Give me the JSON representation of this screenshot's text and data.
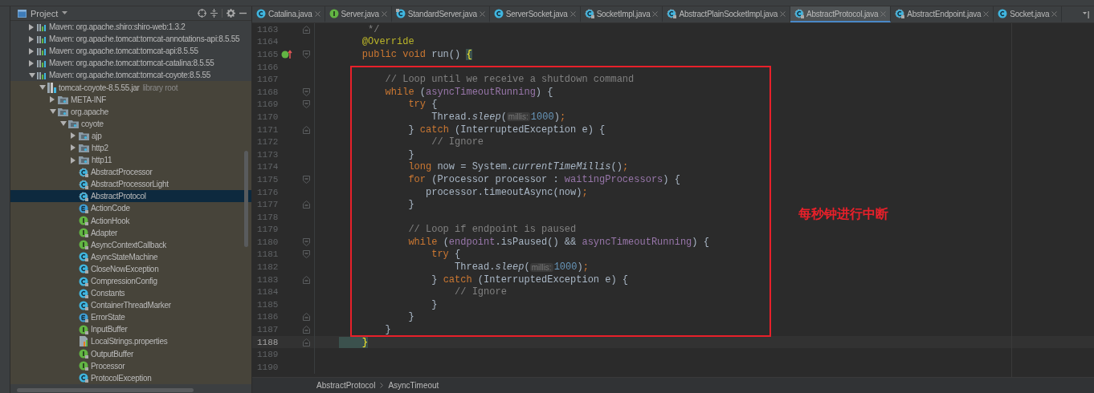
{
  "project_panel": {
    "title": "Project",
    "tree": [
      {
        "label": "Maven: org.apache.shiro:shiro-web:1.3.2",
        "kind": "maven",
        "expanded": false,
        "selected": false
      },
      {
        "label": "Maven: org.apache.tomcat:tomcat-annotations-api:8.5.55",
        "kind": "maven",
        "expanded": false,
        "selected": false
      },
      {
        "label": "Maven: org.apache.tomcat:tomcat-api:8.5.55",
        "kind": "maven",
        "expanded": false,
        "selected": false
      },
      {
        "label": "Maven: org.apache.tomcat:tomcat-catalina:8.5.55",
        "kind": "maven",
        "expanded": false,
        "selected": false
      },
      {
        "label": "Maven: org.apache.tomcat:tomcat-coyote:8.5.55",
        "kind": "maven",
        "expanded": true,
        "selected": false,
        "children": [
          {
            "label": "tomcat-coyote-8.5.55.jar",
            "suffix": "library root",
            "kind": "jar",
            "expanded": true,
            "selected": false,
            "children": [
              {
                "label": "META-INF",
                "kind": "folder",
                "expanded": false,
                "selected": false
              },
              {
                "label": "org.apache",
                "kind": "folder",
                "expanded": true,
                "selected": false,
                "children": [
                  {
                    "label": "coyote",
                    "kind": "folder",
                    "expanded": true,
                    "selected": false,
                    "children": [
                      {
                        "label": "ajp",
                        "kind": "folder",
                        "expanded": false,
                        "selected": false
                      },
                      {
                        "label": "http2",
                        "kind": "folder",
                        "expanded": false,
                        "selected": false
                      },
                      {
                        "label": "http11",
                        "kind": "folder",
                        "expanded": false,
                        "selected": false
                      },
                      {
                        "label": "AbstractProcessor",
                        "kind": "abstract-class",
                        "selected": false
                      },
                      {
                        "label": "AbstractProcessorLight",
                        "kind": "abstract-class",
                        "selected": false
                      },
                      {
                        "label": "AbstractProtocol",
                        "kind": "abstract-class",
                        "selected": true
                      },
                      {
                        "label": "ActionCode",
                        "kind": "enum",
                        "selected": false
                      },
                      {
                        "label": "ActionHook",
                        "kind": "interface",
                        "selected": false
                      },
                      {
                        "label": "Adapter",
                        "kind": "interface",
                        "selected": false
                      },
                      {
                        "label": "AsyncContextCallback",
                        "kind": "interface",
                        "selected": false
                      },
                      {
                        "label": "AsyncStateMachine",
                        "kind": "class",
                        "selected": false
                      },
                      {
                        "label": "CloseNowException",
                        "kind": "class",
                        "selected": false
                      },
                      {
                        "label": "CompressionConfig",
                        "kind": "class",
                        "selected": false
                      },
                      {
                        "label": "Constants",
                        "kind": "final-class",
                        "selected": false
                      },
                      {
                        "label": "ContainerThreadMarker",
                        "kind": "class",
                        "selected": false
                      },
                      {
                        "label": "ErrorState",
                        "kind": "enum",
                        "selected": false
                      },
                      {
                        "label": "InputBuffer",
                        "kind": "interface",
                        "selected": false
                      },
                      {
                        "label": "LocalStrings.properties",
                        "kind": "properties",
                        "selected": false
                      },
                      {
                        "label": "OutputBuffer",
                        "kind": "interface",
                        "selected": false
                      },
                      {
                        "label": "Processor",
                        "kind": "interface",
                        "selected": false
                      },
                      {
                        "label": "ProtocolException",
                        "kind": "class",
                        "selected": false
                      }
                    ]
                  }
                ]
              }
            ]
          }
        ]
      }
    ]
  },
  "tabs": [
    {
      "label": "Catalina.java",
      "kind": "class",
      "selected": false
    },
    {
      "label": "Server.java",
      "kind": "interface",
      "selected": false
    },
    {
      "label": "StandardServer.java",
      "kind": "final-class",
      "selected": false
    },
    {
      "label": "ServerSocket.java",
      "kind": "class",
      "selected": false
    },
    {
      "label": "SocketImpl.java",
      "kind": "abstract-class",
      "selected": false
    },
    {
      "label": "AbstractPlainSocketImpl.java",
      "kind": "abstract-class",
      "selected": false
    },
    {
      "label": "AbstractProtocol.java",
      "kind": "abstract-class",
      "selected": true
    },
    {
      "label": "AbstractEndpoint.java",
      "kind": "abstract-class",
      "selected": false
    },
    {
      "label": "Socket.java",
      "kind": "class",
      "selected": false
    }
  ],
  "code_lines": [
    {
      "number": "1163",
      "current": false,
      "gutter": [
        {
          "kind": "fold-end"
        }
      ],
      "tokens": [
        {
          "kind": "comment",
          "text": "     */"
        }
      ]
    },
    {
      "number": "1164",
      "current": false,
      "tokens": [
        {
          "kind": "annotation",
          "text": "    @Override"
        }
      ]
    },
    {
      "number": "1165",
      "current": false,
      "gutter": [
        {
          "kind": "override"
        },
        {
          "kind": "fold-start"
        }
      ],
      "tokens": [
        {
          "kind": "kw",
          "text": "    public void "
        },
        {
          "kind": "plain",
          "text": "run() "
        },
        {
          "kind": "match",
          "text": "{"
        }
      ]
    },
    {
      "number": "1166",
      "current": false
    },
    {
      "number": "1167",
      "current": false,
      "tokens": [
        {
          "kind": "comment",
          "text": "        // Loop until we receive a shutdown command"
        }
      ]
    },
    {
      "number": "1168",
      "current": false,
      "gutter": [
        {
          "kind": "fold-start"
        }
      ],
      "tokens": [
        {
          "kind": "kw",
          "text": "        while "
        },
        {
          "kind": "plain",
          "text": "("
        },
        {
          "kind": "field",
          "text": "asyncTimeoutRunning"
        },
        {
          "kind": "plain",
          "text": ") {"
        }
      ]
    },
    {
      "number": "1169",
      "current": false,
      "gutter": [
        {
          "kind": "fold-start"
        }
      ],
      "tokens": [
        {
          "kind": "kw",
          "text": "            try "
        },
        {
          "kind": "plain",
          "text": "{"
        }
      ]
    },
    {
      "number": "1170",
      "current": false,
      "tokens": [
        {
          "kind": "plain",
          "text": "                Thread."
        },
        {
          "kind": "static",
          "text": "sleep"
        },
        {
          "kind": "plain",
          "text": "("
        },
        {
          "kind": "hint",
          "text": "millis:"
        },
        {
          "kind": "num",
          "text": "1000"
        },
        {
          "kind": "plain",
          "text": ")"
        },
        {
          "kind": "kw",
          "text": ";"
        }
      ]
    },
    {
      "number": "1171",
      "current": false,
      "gutter": [
        {
          "kind": "fold-end"
        }
      ],
      "tokens": [
        {
          "kind": "plain",
          "text": "            } "
        },
        {
          "kind": "kw",
          "text": "catch "
        },
        {
          "kind": "plain",
          "text": "(InterruptedException e) {"
        }
      ]
    },
    {
      "number": "1172",
      "current": false,
      "tokens": [
        {
          "kind": "comment",
          "text": "                // Ignore"
        }
      ]
    },
    {
      "number": "1173",
      "current": false,
      "tokens": [
        {
          "kind": "plain",
          "text": "            }"
        }
      ]
    },
    {
      "number": "1174",
      "current": false,
      "tokens": [
        {
          "kind": "kw",
          "text": "            long "
        },
        {
          "kind": "plain",
          "text": "now = System."
        },
        {
          "kind": "static",
          "text": "currentTimeMillis"
        },
        {
          "kind": "plain",
          "text": "()"
        },
        {
          "kind": "kw",
          "text": ";"
        }
      ]
    },
    {
      "number": "1175",
      "current": false,
      "gutter": [
        {
          "kind": "fold-start"
        }
      ],
      "tokens": [
        {
          "kind": "kw",
          "text": "            for "
        },
        {
          "kind": "plain",
          "text": "(Processor processor : "
        },
        {
          "kind": "field",
          "text": "waitingProcessors"
        },
        {
          "kind": "plain",
          "text": ") {"
        }
      ]
    },
    {
      "number": "1176",
      "current": false,
      "tokens": [
        {
          "kind": "plain",
          "text": "               processor.timeoutAsync(now)"
        },
        {
          "kind": "kw",
          "text": ";"
        }
      ]
    },
    {
      "number": "1177",
      "current": false,
      "gutter": [
        {
          "kind": "fold-end"
        }
      ],
      "tokens": [
        {
          "kind": "plain",
          "text": "            }"
        }
      ]
    },
    {
      "number": "1178",
      "current": false
    },
    {
      "number": "1179",
      "current": false,
      "tokens": [
        {
          "kind": "comment",
          "text": "            // Loop if endpoint is paused"
        }
      ]
    },
    {
      "number": "1180",
      "current": false,
      "gutter": [
        {
          "kind": "fold-start"
        }
      ],
      "tokens": [
        {
          "kind": "kw",
          "text": "            while "
        },
        {
          "kind": "plain",
          "text": "("
        },
        {
          "kind": "field",
          "text": "endpoint"
        },
        {
          "kind": "plain",
          "text": ".isPaused() && "
        },
        {
          "kind": "field",
          "text": "asyncTimeoutRunning"
        },
        {
          "kind": "plain",
          "text": ") {"
        }
      ]
    },
    {
      "number": "1181",
      "current": false,
      "gutter": [
        {
          "kind": "fold-start"
        }
      ],
      "tokens": [
        {
          "kind": "kw",
          "text": "                try "
        },
        {
          "kind": "plain",
          "text": "{"
        }
      ]
    },
    {
      "number": "1182",
      "current": false,
      "tokens": [
        {
          "kind": "plain",
          "text": "                    Thread."
        },
        {
          "kind": "static",
          "text": "sleep"
        },
        {
          "kind": "plain",
          "text": "("
        },
        {
          "kind": "hint",
          "text": "millis:"
        },
        {
          "kind": "num",
          "text": "1000"
        },
        {
          "kind": "plain",
          "text": ")"
        },
        {
          "kind": "kw",
          "text": ";"
        }
      ]
    },
    {
      "number": "1183",
      "current": false,
      "gutter": [
        {
          "kind": "fold-end"
        }
      ],
      "tokens": [
        {
          "kind": "plain",
          "text": "                } "
        },
        {
          "kind": "kw",
          "text": "catch "
        },
        {
          "kind": "plain",
          "text": "(InterruptedException e) {"
        }
      ]
    },
    {
      "number": "1184",
      "current": false,
      "tokens": [
        {
          "kind": "comment",
          "text": "                    // Ignore"
        }
      ]
    },
    {
      "number": "1185",
      "current": false,
      "tokens": [
        {
          "kind": "plain",
          "text": "                }"
        }
      ]
    },
    {
      "number": "1186",
      "current": false,
      "gutter": [
        {
          "kind": "fold-end"
        }
      ],
      "tokens": [
        {
          "kind": "plain",
          "text": "            }"
        }
      ]
    },
    {
      "number": "1187",
      "current": false,
      "gutter": [
        {
          "kind": "fold-end"
        }
      ],
      "tokens": [
        {
          "kind": "plain",
          "text": "        }"
        }
      ]
    },
    {
      "number": "1188",
      "current": true,
      "gutter": [
        {
          "kind": "fold-end"
        }
      ],
      "tokens": [
        {
          "kind": "match",
          "text": "    }"
        }
      ]
    },
    {
      "number": "1189",
      "current": false
    },
    {
      "number": "1190",
      "current": false
    }
  ],
  "annotation": {
    "text": "每秒钟进行中断"
  },
  "breadcrumbs": [
    "AbstractProtocol",
    "AsyncTimeout"
  ]
}
